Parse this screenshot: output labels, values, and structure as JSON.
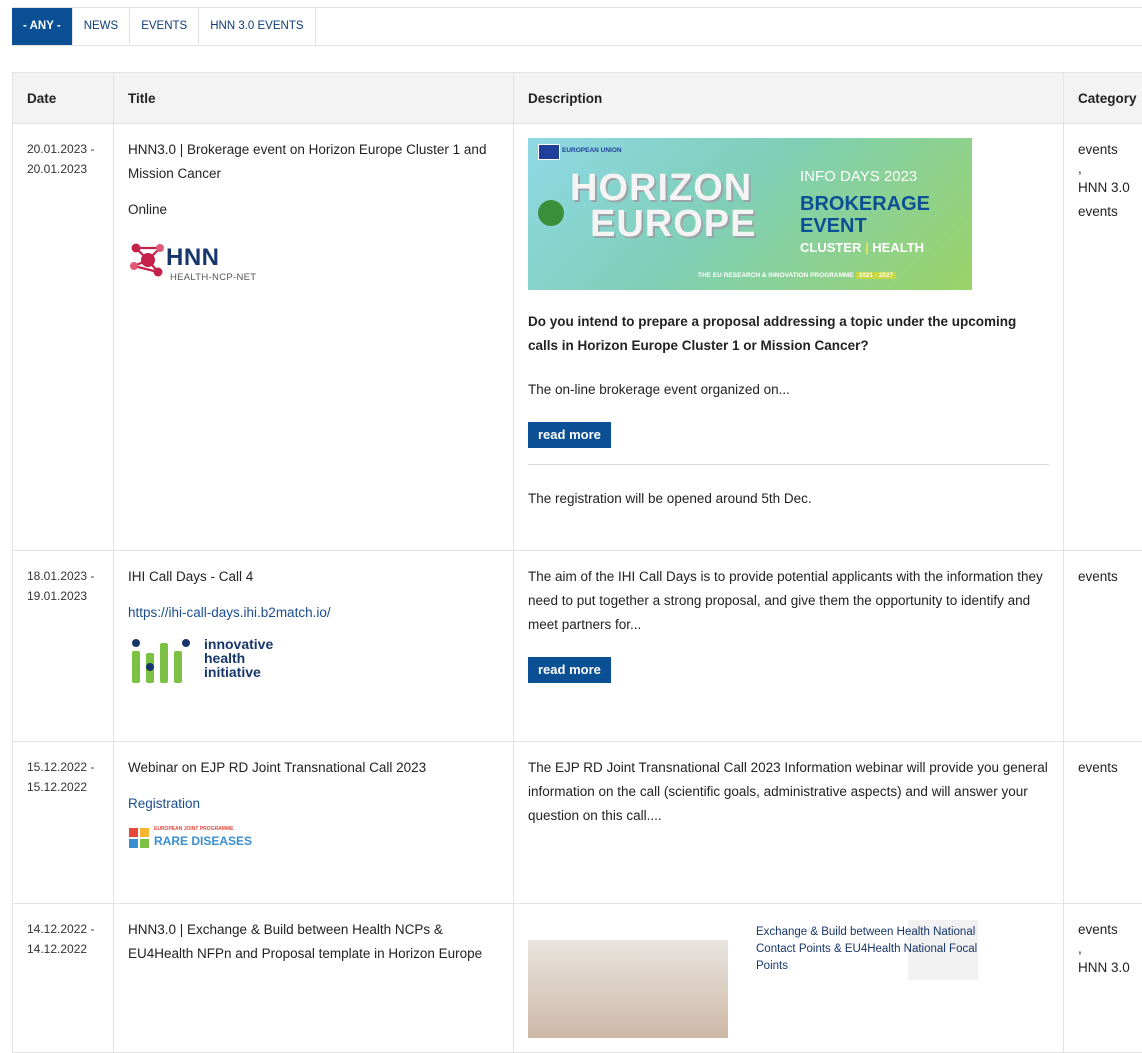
{
  "tabs": [
    {
      "label": "- ANY -",
      "active": true
    },
    {
      "label": "NEWS"
    },
    {
      "label": "EVENTS"
    },
    {
      "label": "HNN 3.0 EVENTS"
    }
  ],
  "headers": {
    "date": "Date",
    "title": "Title",
    "description": "Description",
    "category": "Category"
  },
  "rows": [
    {
      "date_from": "20.01.2023 -",
      "date_to": "20.01.2023",
      "title": "HNN3.0 | Brokerage event on Horizon Europe Cluster 1 and Mission Cancer",
      "sub": "Online",
      "logo": {
        "main": "HNN",
        "sub": "HEALTH-NCP-NET"
      },
      "banner": {
        "eu": "EUROPEAN UNION",
        "horizon": "HORIZON",
        "europe": "EUROPE",
        "info": "INFO DAYS 2023",
        "brokerage": "BROKERAGE",
        "event": "EVENT",
        "cluster": "CLUSTER",
        "health": "HEALTH",
        "programme": "THE EU RESEARCH & INNOVATION PROGRAMME",
        "years": "2021 - 2027"
      },
      "desc_bold": "Do you intend to prepare a proposal addressing a topic under the upcoming calls in Horizon Europe Cluster 1 or Mission Cancer?",
      "desc": "The on-line brokerage event organized on...",
      "read_more": "read more",
      "desc_after": "The registration will be opened around 5th Dec.",
      "cat1": "events",
      "cat_sep": ",",
      "cat2": "HNN 3.0 events"
    },
    {
      "date_from": "18.01.2023 -",
      "date_to": "19.01.2023",
      "title": "IHI Call Days - Call 4",
      "link": "https://ihi-call-days.ihi.b2match.io/",
      "logo": {
        "l1": "innovative",
        "l2": "health",
        "l3": "initiative"
      },
      "desc": "The aim of the IHI Call Days is to provide potential applicants with the information they need to put together a strong proposal, and give them the opportunity to identify and meet partners for...",
      "read_more": "read more",
      "cat1": "events"
    },
    {
      "date_from": "15.12.2022 -",
      "date_to": "15.12.2022",
      "title": "Webinar on EJP RD Joint Transnational Call 2023",
      "link": "Registration",
      "logo": {
        "top": "EUROPEAN JOINT PROGRAMME",
        "main": "RARE DISEASES"
      },
      "desc": "The EJP RD Joint Transnational Call 2023 Information webinar will provide you general information on the call (scientific goals, administrative aspects) and will answer your question on this call....",
      "cat1": "events"
    },
    {
      "date_from": "14.12.2022 -",
      "date_to": "14.12.2022",
      "title": "HNN3.0 | Exchange & Build between Health NCPs & EU4Health NFPn and Proposal template in Horizon Europe",
      "image_text": "Exchange & Build between Health National Contact Points & EU4Health National Focal Points",
      "cat1": "events",
      "cat_sep": ",",
      "cat2": "HNN 3.0"
    }
  ]
}
